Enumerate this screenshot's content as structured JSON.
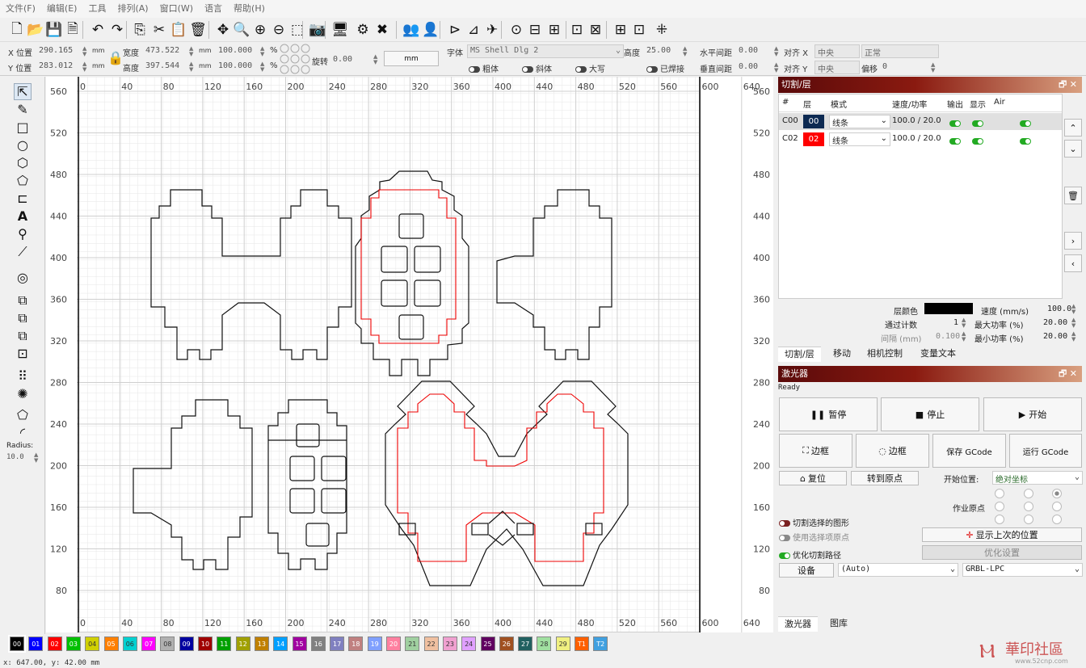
{
  "menu": [
    "文件(F)",
    "编辑(E)",
    "工具",
    "排列(A)",
    "窗口(W)",
    "语言",
    "帮助(H)"
  ],
  "toolbar_icons": [
    "new-file-icon",
    "open-folder-icon",
    "save-icon",
    "save-as-icon",
    "undo-icon",
    "redo-icon",
    "copy-icon",
    "cut-icon",
    "paste-icon",
    "delete-icon",
    "move-icon",
    "zoom-fit-icon",
    "zoom-in-icon",
    "zoom-out-icon",
    "select-frame-icon",
    "camera-icon",
    "monitor-icon",
    "settings-icon",
    "tools-icon",
    "users-icon",
    "user-icon",
    "mirror-h-icon",
    "mirror-v-icon",
    "send-icon",
    "target-icon",
    "align-icon",
    "align2-icon",
    "distribute-icon",
    "distribute2-icon",
    "align3-icon",
    "align4-icon",
    "center-icon"
  ],
  "props": {
    "x_label": "X 位置",
    "x_value": "290.165",
    "y_label": "Y 位置",
    "y_value": "283.012",
    "unit": "mm",
    "w_label": "宽度",
    "w_value": "473.522",
    "h_label": "高度",
    "h_value": "397.544",
    "w_pct": "100.000",
    "h_pct": "100.000",
    "pct": "%",
    "rot_label": "旋转",
    "rot_value": "0.00",
    "unit_btn": "mm",
    "font_label": "字体",
    "font_value": "MS Shell Dlg 2",
    "height_label": "高度",
    "height_value": "25.00",
    "hspace_label": "水平间距",
    "hspace_value": "0.00",
    "vspace_label": "垂直间距",
    "vspace_value": "0.00",
    "bold": "粗体",
    "italic": "斜体",
    "caps": "大写",
    "welded": "已焊接",
    "alignx_label": "对齐 X",
    "alignx_value": "中央",
    "normal": "正常",
    "aligny_label": "对齐 Y",
    "aligny_value": "中央",
    "offset_label": "偏移",
    "offset_value": "0"
  },
  "left_tools": {
    "radius_label": "Radius:",
    "radius_value": "10.0"
  },
  "axis": {
    "x_ticks": [
      "0",
      "40",
      "80",
      "120",
      "160",
      "200",
      "240",
      "280",
      "320",
      "360",
      "400",
      "440",
      "480",
      "520",
      "560",
      "600",
      "640"
    ],
    "y_ticks": [
      "560",
      "520",
      "480",
      "440",
      "400",
      "360",
      "320",
      "280",
      "240",
      "200",
      "160",
      "120",
      "80"
    ]
  },
  "cuts_panel": {
    "title": "切割/层",
    "headers": [
      "#",
      "层",
      "模式",
      "速度/功率",
      "输出",
      "显示",
      "Air"
    ],
    "rows": [
      {
        "id": "C00",
        "layer": "00",
        "color": "#0d2a52",
        "mode": "线条",
        "speed": "100.0 / 20.0"
      },
      {
        "id": "C02",
        "layer": "02",
        "color": "#ff0000",
        "mode": "线条",
        "speed": "100.0 / 20.0"
      }
    ],
    "layer_color_label": "层颜色",
    "speed_label": "速度 (mm/s)",
    "speed_value": "100.0",
    "passes_label": "通过计数",
    "passes_value": "1",
    "max_power_label": "最大功率 (%)",
    "max_power_value": "20.00",
    "interval_label": "间隔 (mm)",
    "interval_value": "0.100",
    "min_power_label": "最小功率 (%)",
    "min_power_value": "20.00",
    "tabs": [
      "切割/层",
      "移动",
      "相机控制",
      "变量文本"
    ]
  },
  "laser_panel": {
    "title": "激光器",
    "status": "Ready",
    "pause": "暂停",
    "stop": "停止",
    "start": "开始",
    "frame1": "边框",
    "frame2": "边框",
    "save_gcode": "保存 GCode",
    "run_gcode": "运行 GCode",
    "home": "复位",
    "goto_origin": "转到原点",
    "start_pos_label": "开始位置:",
    "start_pos_value": "绝对坐标",
    "job_origin_label": "作业原点",
    "cut_selected": "切割选择的图形",
    "use_selection_origin": "使用选择项原点",
    "optimize": "优化切割路径",
    "show_last": "显示上次的位置",
    "opt_settings": "优化设置",
    "device": "设备",
    "device_value": "(Auto)",
    "controller": "GRBL-LPC",
    "tabs": [
      "激光器",
      "图库"
    ]
  },
  "palette": [
    {
      "l": "00",
      "c": "#000000"
    },
    {
      "l": "01",
      "c": "#0000ff"
    },
    {
      "l": "02",
      "c": "#ff0000"
    },
    {
      "l": "03",
      "c": "#00c000"
    },
    {
      "l": "04",
      "c": "#d0d000"
    },
    {
      "l": "05",
      "c": "#ff8000"
    },
    {
      "l": "06",
      "c": "#00d0d0"
    },
    {
      "l": "07",
      "c": "#ff00ff"
    },
    {
      "l": "08",
      "c": "#b0b0b0"
    },
    {
      "l": "09",
      "c": "#0000a0"
    },
    {
      "l": "10",
      "c": "#a00000"
    },
    {
      "l": "11",
      "c": "#00a000"
    },
    {
      "l": "12",
      "c": "#a0a000"
    },
    {
      "l": "13",
      "c": "#c08000"
    },
    {
      "l": "14",
      "c": "#00a0ff"
    },
    {
      "l": "15",
      "c": "#a000a0"
    },
    {
      "l": "16",
      "c": "#808080"
    },
    {
      "l": "17",
      "c": "#8080c0"
    },
    {
      "l": "18",
      "c": "#c08080"
    },
    {
      "l": "19",
      "c": "#80a0ff"
    },
    {
      "l": "20",
      "c": "#ff80a0"
    },
    {
      "l": "21",
      "c": "#a0d0a0"
    },
    {
      "l": "22",
      "c": "#f0c0a0"
    },
    {
      "l": "23",
      "c": "#f0a0d0"
    },
    {
      "l": "24",
      "c": "#e0a0ff"
    },
    {
      "l": "25",
      "c": "#600060"
    },
    {
      "l": "26",
      "c": "#a05020"
    },
    {
      "l": "27",
      "c": "#206060"
    },
    {
      "l": "28",
      "c": "#a0e0a0"
    },
    {
      "l": "29",
      "c": "#f0f080"
    },
    {
      "l": "T1",
      "c": "#ff6000"
    },
    {
      "l": "T2",
      "c": "#40a0e0"
    }
  ],
  "status": "x: 647.00, y: 42.00 mm",
  "watermark": "華印社區",
  "watermark_url": "www.52cnp.com"
}
